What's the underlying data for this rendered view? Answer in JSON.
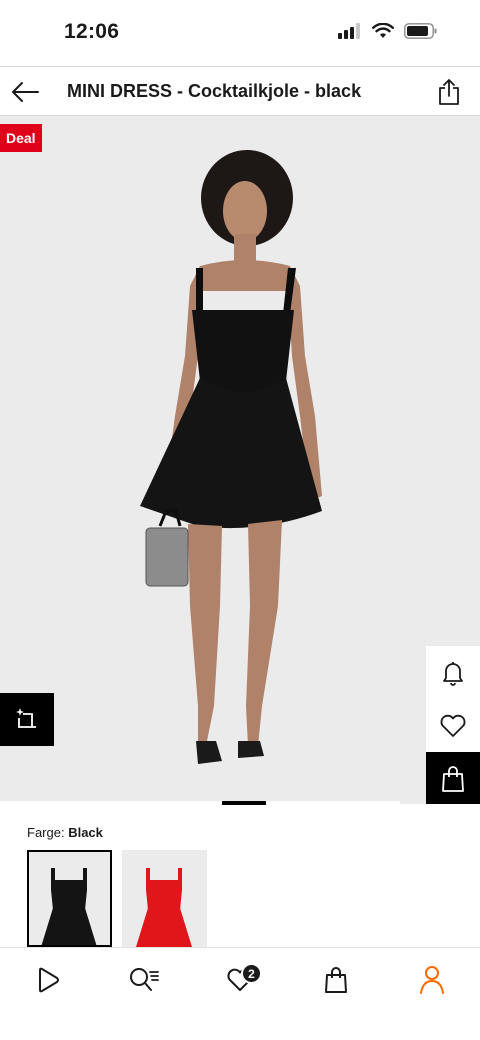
{
  "status_bar": {
    "time": "12:06"
  },
  "header": {
    "title": "MINI DRESS - Cocktailkjole - black",
    "back_icon": "arrow-left-icon",
    "share_icon": "share-icon"
  },
  "gallery": {
    "deal_label": "Deal",
    "side_actions": [
      "bell-icon",
      "heart-icon",
      "shopping-bag-icon"
    ],
    "compare_icon": "sparkle-crop-icon",
    "position": 0.6
  },
  "color_selector": {
    "label": "Farge:",
    "selected": "Black",
    "swatches": [
      {
        "color": "#141414",
        "selected": true
      },
      {
        "color": "#e0161b",
        "selected": false
      }
    ]
  },
  "tabbar": {
    "tabs": [
      "play-icon",
      "search-list-icon",
      "heart-icon",
      "shopping-bag-icon",
      "person-icon"
    ],
    "wishlist_count": "2",
    "active_color": "#ff6900"
  },
  "colors": {
    "deal": "#e0001a",
    "accent": "#ff6900"
  }
}
